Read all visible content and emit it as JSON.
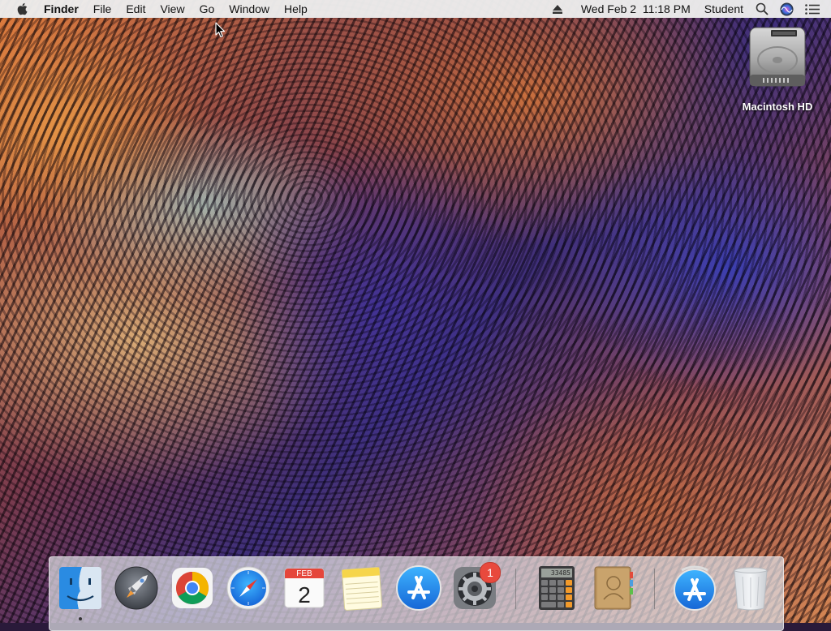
{
  "menubar": {
    "apple_icon": "apple-logo-icon",
    "items": [
      {
        "label": "Finder"
      },
      {
        "label": "File"
      },
      {
        "label": "Edit"
      },
      {
        "label": "View"
      },
      {
        "label": "Go"
      },
      {
        "label": "Window"
      },
      {
        "label": "Help"
      }
    ],
    "status": {
      "eject_icon": "eject-icon",
      "datetime": "Wed Feb 2  11:18 PM",
      "user": "Student",
      "spotlight_icon": "spotlight-search-icon",
      "siri_icon": "siri-icon",
      "notification_icon": "notification-center-icon"
    }
  },
  "desktop": {
    "icons": [
      {
        "label": "Macintosh HD",
        "icon": "hard-drive-icon"
      }
    ]
  },
  "dock": {
    "apps": [
      {
        "name": "Finder",
        "icon": "finder-icon",
        "running": true
      },
      {
        "name": "Launchpad",
        "icon": "launchpad-icon"
      },
      {
        "name": "Google Chrome",
        "icon": "chrome-icon"
      },
      {
        "name": "Safari",
        "icon": "safari-icon"
      },
      {
        "name": "Calendar",
        "icon": "calendar-icon",
        "month": "FEB",
        "day": "2"
      },
      {
        "name": "Notes",
        "icon": "notes-icon"
      },
      {
        "name": "App Store",
        "icon": "app-store-icon"
      },
      {
        "name": "System Preferences",
        "icon": "system-preferences-icon",
        "badge": "1"
      },
      {
        "name": "Calculator",
        "icon": "calculator-icon",
        "display": "33485"
      },
      {
        "name": "Contacts",
        "icon": "contacts-icon"
      },
      {
        "name": "App Store",
        "icon": "app-store-icon"
      },
      {
        "name": "Trash",
        "icon": "trash-icon"
      }
    ]
  },
  "colors": {
    "menubar_bg": "#ececec",
    "badge": "#e8493d",
    "appstore_blue": "#1e8cf0"
  }
}
